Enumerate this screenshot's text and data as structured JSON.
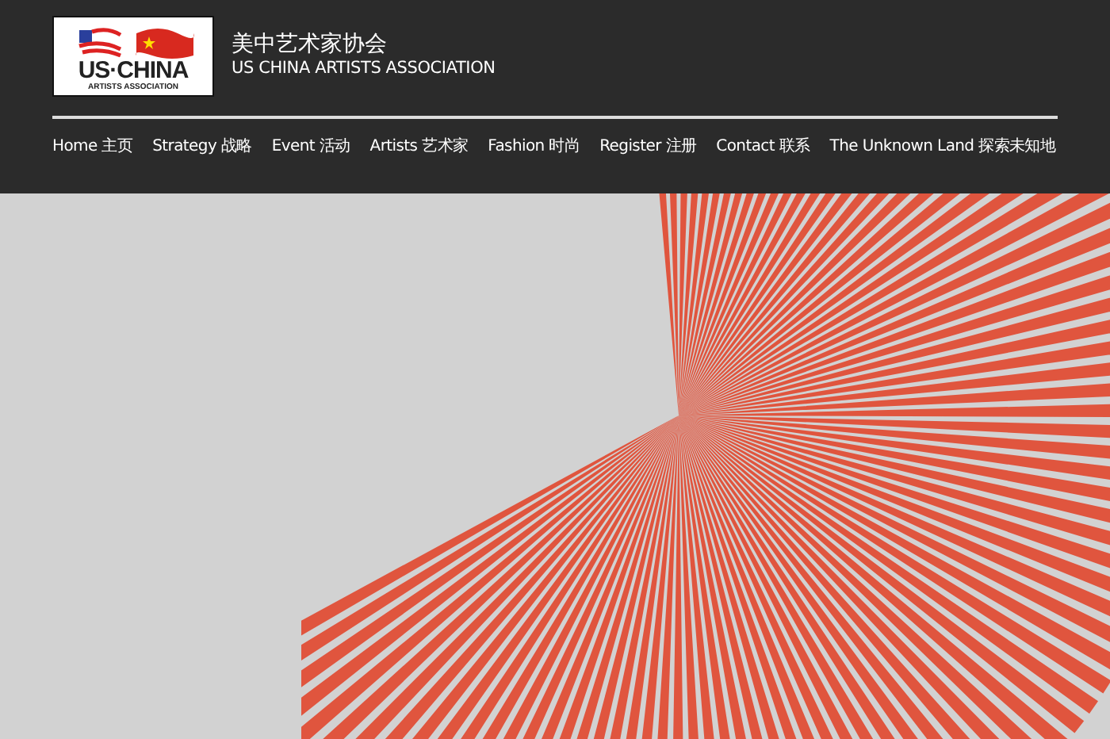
{
  "logo": {
    "wordmark": "US·CHINA",
    "tagline": "ARTISTS ASSOCIATION"
  },
  "site": {
    "title": "美中艺术家协会",
    "subtitle": "US CHINA ARTISTS ASSOCIATION"
  },
  "nav": [
    {
      "label": "Home 主页"
    },
    {
      "label": "Strategy 战略"
    },
    {
      "label": "Event 活动"
    },
    {
      "label": "Artists 艺术家"
    },
    {
      "label": "Fashion 时尚"
    },
    {
      "label": "Register 注册"
    },
    {
      "label": "Contact 联系"
    },
    {
      "label": "The Unknown Land 探索未知地"
    }
  ]
}
